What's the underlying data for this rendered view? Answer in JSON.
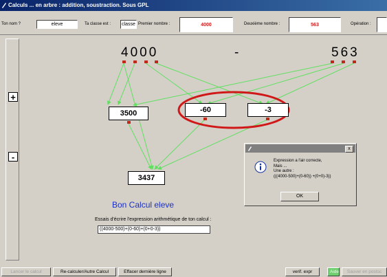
{
  "window": {
    "title": "Calculs ... en arbre : addition, soustraction. Sous GPL"
  },
  "topbar": {
    "name_label": "Ton nom ?",
    "name_value": "eleve",
    "class_label": "Ta classe est :",
    "class_value": "classe",
    "first_label": "Premier nombre :",
    "first_value": "4000",
    "second_label": "Deuxième nombre :",
    "second_value": "563",
    "operation_label": "Opération :"
  },
  "left_rail": {
    "plus": "+",
    "minus": "-"
  },
  "tree": {
    "first_number": "4000",
    "operator": "-",
    "second_number": "563",
    "box_3500": "3500",
    "box_m60": "-60",
    "box_m3": "-3",
    "result": "3437"
  },
  "feedback": {
    "message": "Bon Calcul eleve",
    "prompt": "Essais d'écrire l'expression arithmétique de ton calcul :",
    "expression": "((4000-500)+(0-60)+(0+0-3))"
  },
  "dialog": {
    "line1": "Expression a l'air correcte,",
    "line2": "Mais ...",
    "line3": "Une autre :",
    "line4": "(((4000-500)+(0-60)) +(0+0)-3))",
    "ok": "OK",
    "close": "x",
    "icon": "info-icon"
  },
  "bottombar": {
    "launch": "Lancer le calcul",
    "recalc": "Re-calculer/Autre Calcul",
    "erase": "Effacer dernière ligne",
    "verif": "verif. expr",
    "aide": "Aide",
    "save": "Sauver en postsc"
  },
  "colors": {
    "arrow": "#5fe05f",
    "marker": "#c0281c",
    "ellipse": "#d01818",
    "big_number": "#e01010",
    "message": "#1a2fc8"
  }
}
